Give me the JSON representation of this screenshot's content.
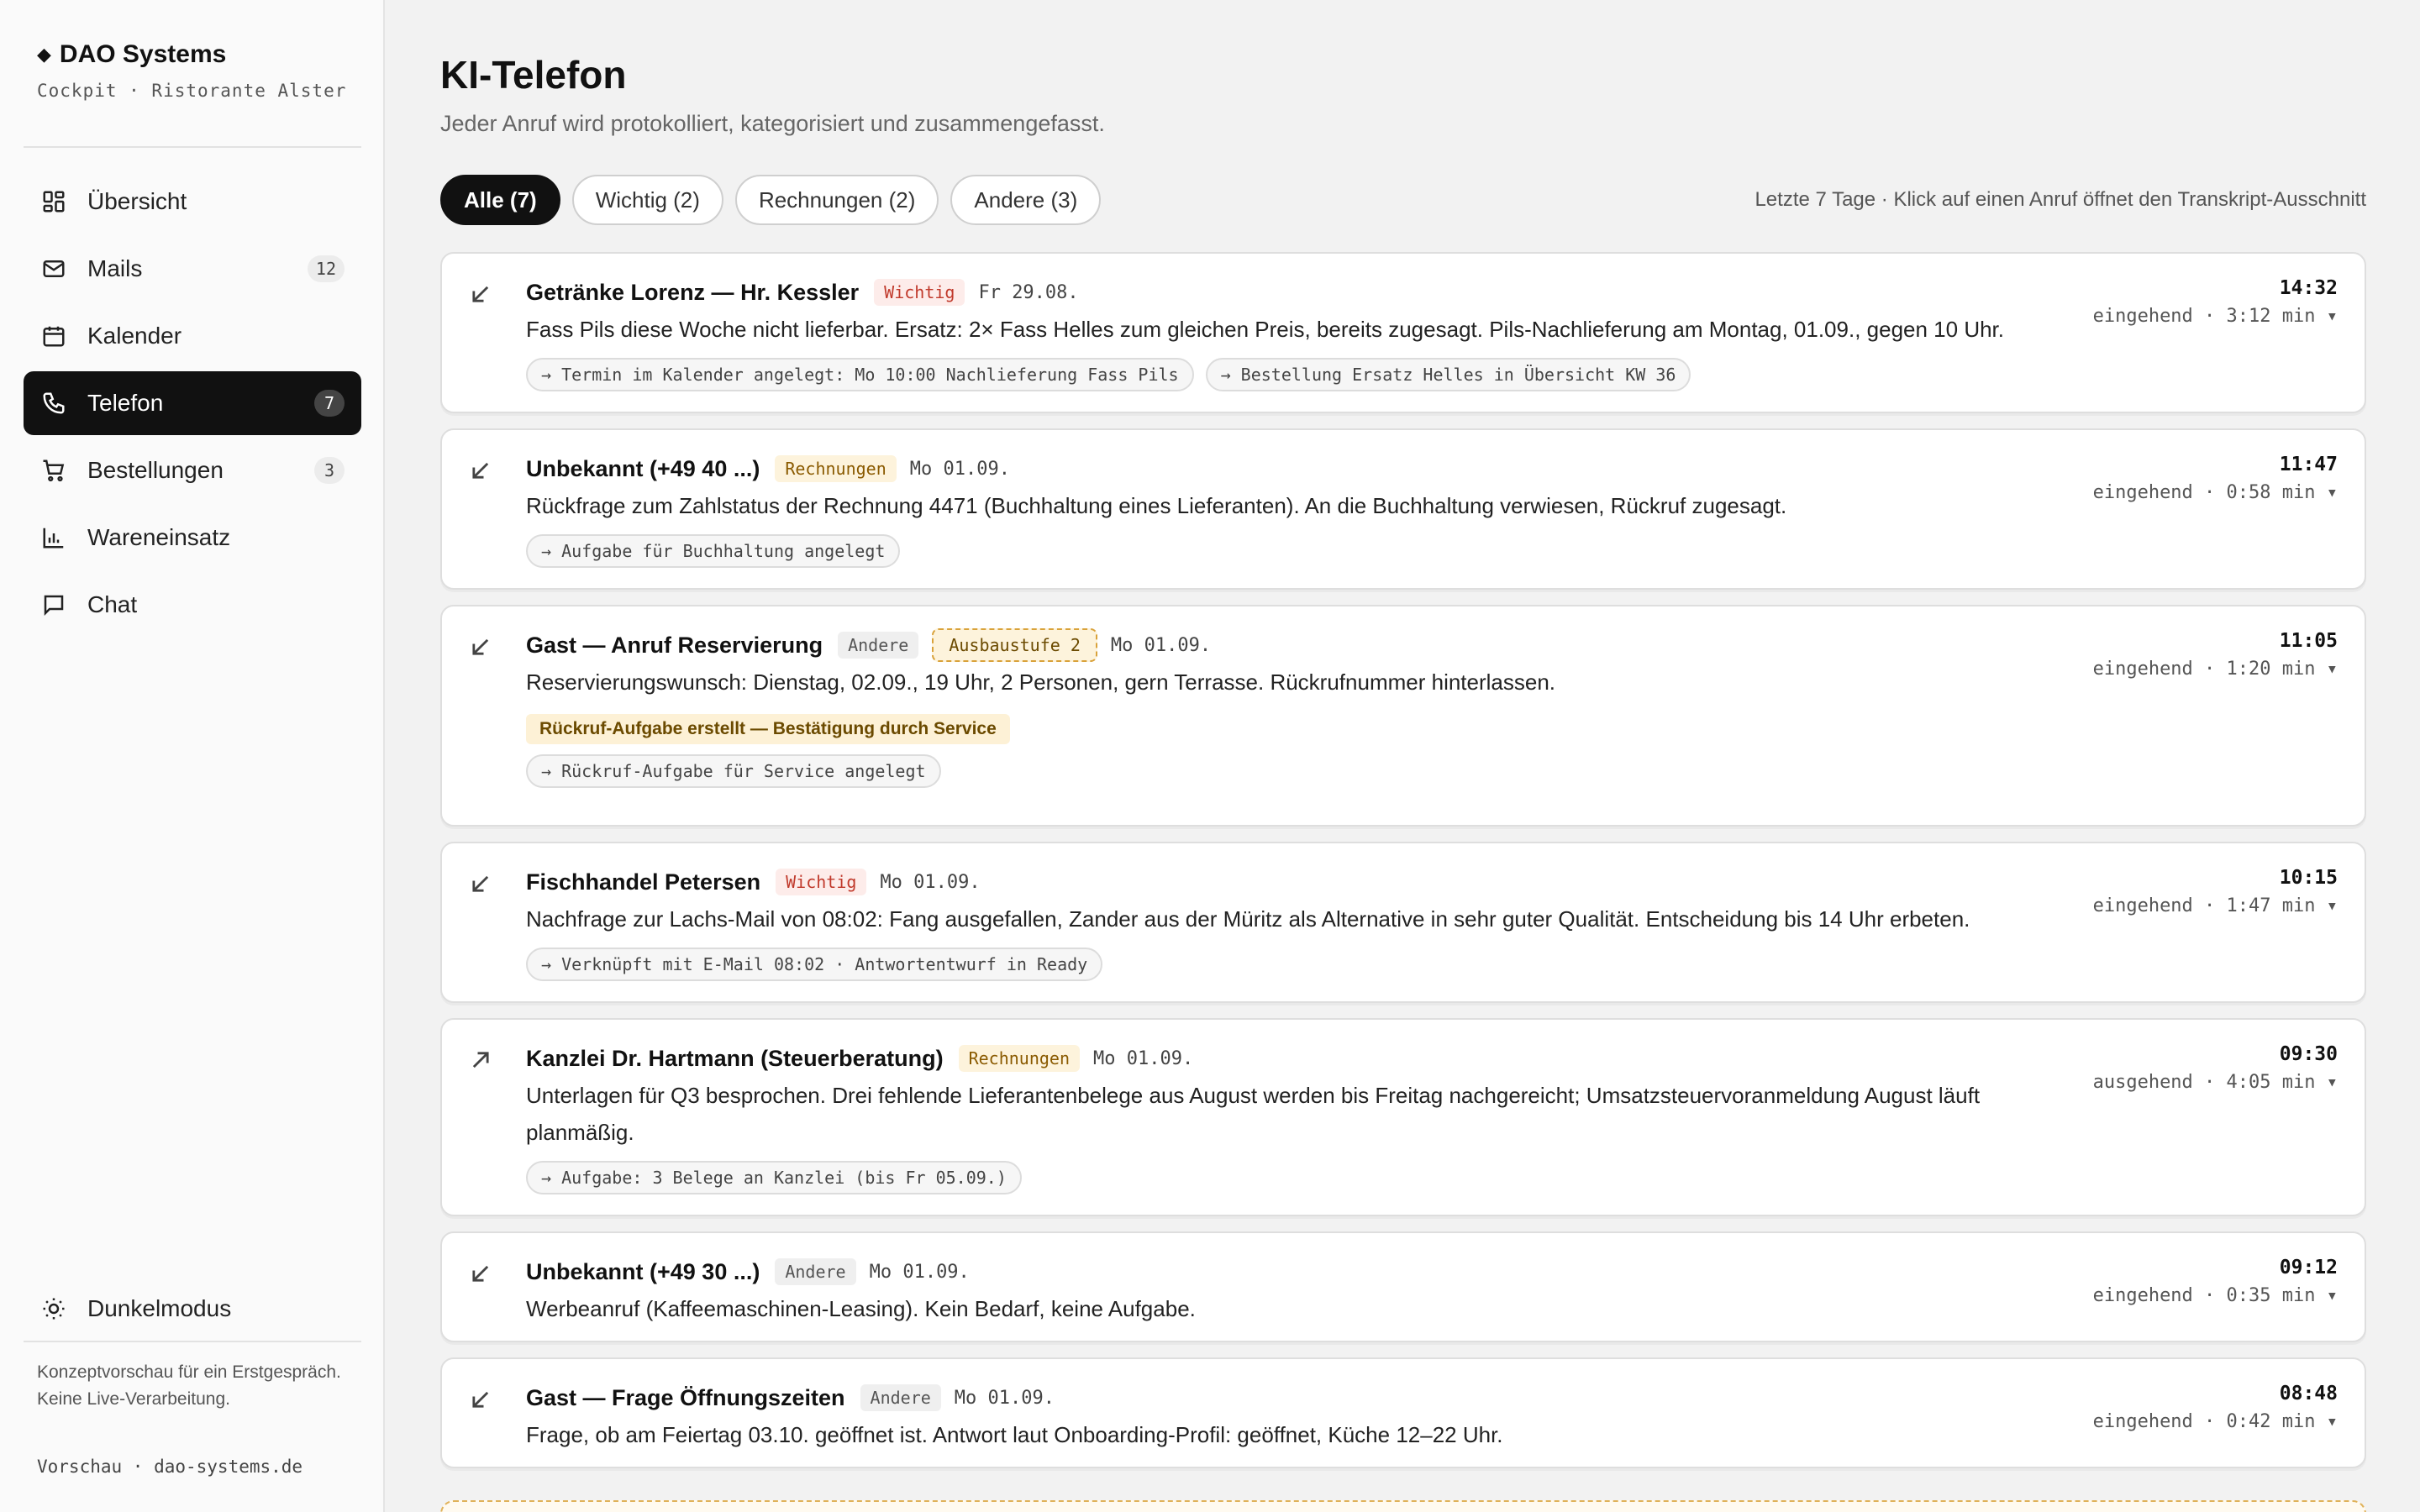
{
  "brand": {
    "name": "DAO Systems",
    "subtitle": "Cockpit · Ristorante Alster"
  },
  "nav": [
    {
      "label": "Übersicht",
      "icon": "grid-icon",
      "badge": null
    },
    {
      "label": "Mails",
      "icon": "mail-icon",
      "badge": "12"
    },
    {
      "label": "Kalender",
      "icon": "calendar-icon",
      "badge": null
    },
    {
      "label": "Telefon",
      "icon": "phone-icon",
      "badge": "7",
      "active": true
    },
    {
      "label": "Bestellungen",
      "icon": "cart-icon",
      "badge": "3"
    },
    {
      "label": "Wareneinsatz",
      "icon": "bar-chart-icon",
      "badge": null
    },
    {
      "label": "Chat",
      "icon": "chat-bubble-icon",
      "badge": null
    }
  ],
  "sidebar_footer": {
    "dark_mode_label": "Dunkelmodus",
    "note": "Konzeptvorschau für ein Erstgespräch. Keine Live-Verarbeitung.",
    "link": "Vorschau · dao-systems.de"
  },
  "page": {
    "title": "KI-Telefon",
    "subtitle": "Jeder Anruf wird protokolliert, kategorisiert und zusammengefasst."
  },
  "filters": [
    {
      "label": "Alle (7)",
      "active": true
    },
    {
      "label": "Wichtig (2)"
    },
    {
      "label": "Rechnungen (2)"
    },
    {
      "label": "Andere (3)"
    }
  ],
  "filter_hint": "Letzte 7 Tage · Klick auf einen Anruf öffnet den Transkript-Ausschnitt",
  "calls": [
    {
      "direction": "incoming",
      "name": "Getränke Lorenz — Hr. Kessler",
      "tag": "Wichtig",
      "date": "Fr 29.08.",
      "summary": "Fass Pils diese Woche nicht lieferbar. Ersatz: 2× Fass Helles zum gleichen Preis, bereits zugesagt. Pils-Nachlieferung am Montag, 01.09., gegen 10 Uhr.",
      "chips": [
        "→ Termin im Kalender angelegt: Mo 10:00 Nachlieferung Fass Pils",
        "→ Bestellung Ersatz Helles in Übersicht KW 36"
      ],
      "time": "14:32",
      "duration": "eingehend · 3:12 min ▾"
    },
    {
      "direction": "incoming",
      "name": "Unbekannt (+49 40 ...)",
      "tag": "Rechnungen",
      "date": "Mo 01.09.",
      "summary": "Rückfrage zum Zahlstatus der Rechnung 4471 (Buchhaltung eines Lieferanten). An die Buchhaltung verwiesen, Rückruf zugesagt.",
      "chips": [
        "→ Aufgabe für Buchhaltung angelegt"
      ],
      "time": "11:47",
      "duration": "eingehend · 0:58 min ▾"
    },
    {
      "direction": "incoming",
      "name": "Gast — Anruf Reservierung",
      "tag": "Andere",
      "stage": "Ausbaustufe 2",
      "date": "Mo 01.09.",
      "summary": "Reservierungswunsch: Dienstag, 02.09., 19 Uhr, 2 Personen, gern Terrasse. Rückrufnummer hinterlassen.",
      "notice": "Rückruf-Aufgabe erstellt — Bestätigung durch Service",
      "chips": [
        "→ Rückruf-Aufgabe für Service angelegt"
      ],
      "time": "11:05",
      "duration": "eingehend · 1:20 min ▾"
    },
    {
      "direction": "incoming",
      "name": "Fischhandel Petersen",
      "tag": "Wichtig",
      "date": "Mo 01.09.",
      "summary": "Nachfrage zur Lachs-Mail von 08:02: Fang ausgefallen, Zander aus der Müritz als Alternative in sehr guter Qualität. Entscheidung bis 14 Uhr erbeten.",
      "chips": [
        "→ Verknüpft mit E-Mail 08:02 · Antwortentwurf in Ready"
      ],
      "time": "10:15",
      "duration": "eingehend · 1:47 min ▾"
    },
    {
      "direction": "outgoing",
      "name": "Kanzlei Dr. Hartmann (Steuerberatung)",
      "tag": "Rechnungen",
      "date": "Mo 01.09.",
      "summary": "Unterlagen für Q3 besprochen. Drei fehlende Lieferantenbelege aus August werden bis Freitag nachgereicht; Umsatzsteuervoranmeldung August läuft planmäßig.",
      "chips": [
        "→ Aufgabe: 3 Belege an Kanzlei (bis Fr 05.09.)"
      ],
      "time": "09:30",
      "duration": "ausgehend · 4:05 min ▾"
    },
    {
      "direction": "incoming",
      "name": "Unbekannt (+49 30 ...)",
      "tag": "Andere",
      "date": "Mo 01.09.",
      "summary": "Werbeanruf (Kaffeemaschinen-Leasing). Kein Bedarf, keine Aufgabe.",
      "chips": [],
      "time": "09:12",
      "duration": "eingehend · 0:35 min ▾"
    },
    {
      "direction": "incoming",
      "name": "Gast — Frage Öffnungszeiten",
      "tag": "Andere",
      "date": "Mo 01.09.",
      "summary": "Frage, ob am Feiertag 03.10. geöffnet ist. Antwort laut Onboarding-Profil: geöffnet, Küche 12–22 Uhr.",
      "chips": [],
      "time": "08:48",
      "duration": "eingehend · 0:42 min ▾"
    }
  ]
}
